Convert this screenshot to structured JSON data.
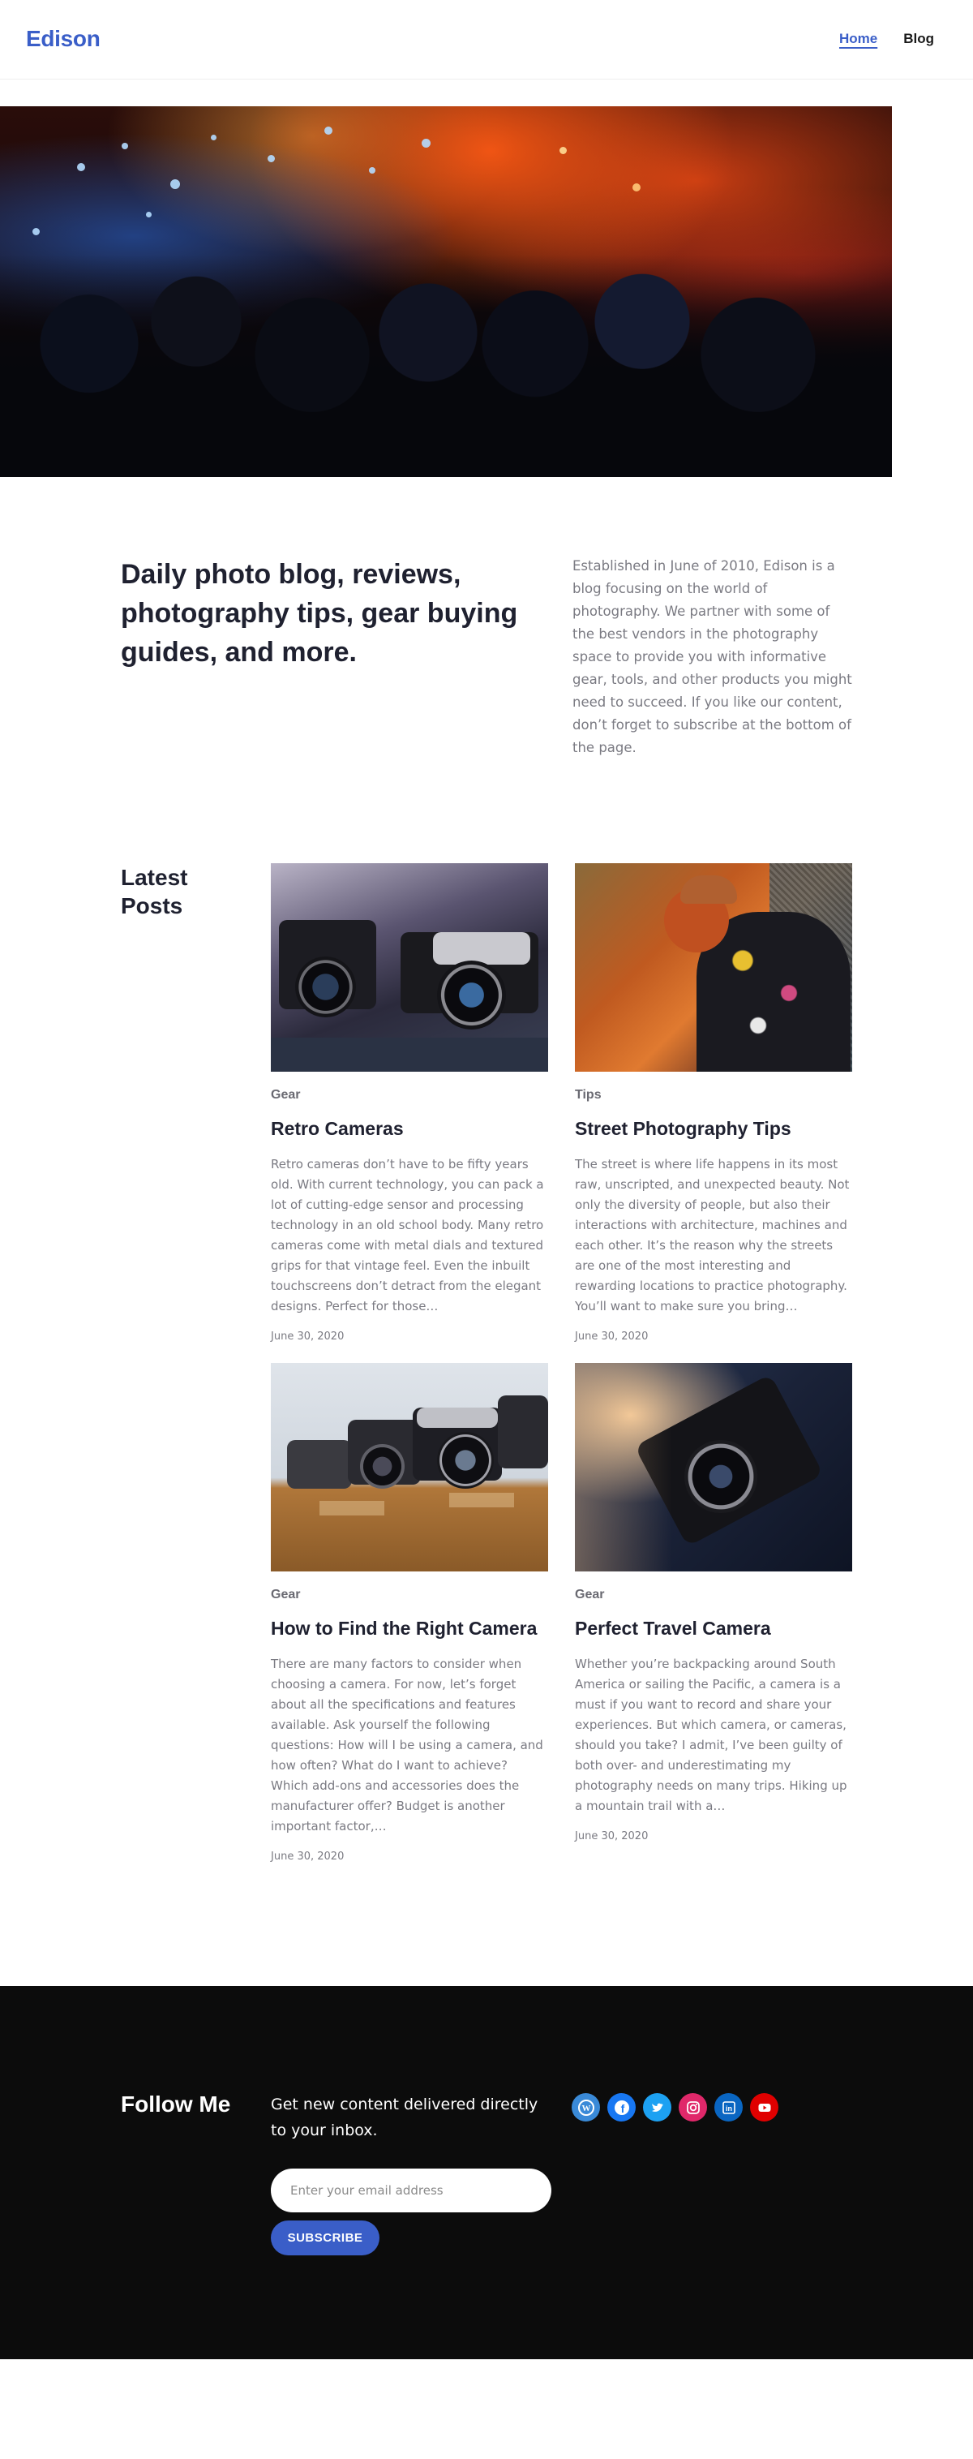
{
  "header": {
    "logo": "Edison",
    "nav": [
      {
        "label": "Home",
        "active": true
      },
      {
        "label": "Blog",
        "active": false
      }
    ]
  },
  "intro": {
    "title": "Daily photo blog, reviews, photography tips, gear buying guides, and more.",
    "text": "Established in June of 2010, Edison is a blog focusing on the world of photography. We partner with some of the best vendors in the photography space to provide you with informative gear, tools, and other products you might need to succeed. If you like our content, don’t forget to subscribe at the bottom of the page."
  },
  "latest": {
    "title": "Latest Posts",
    "posts": [
      {
        "category": "Gear",
        "title": "Retro Cameras",
        "excerpt": "Retro cameras don’t have to be fifty years old. With current technology, you can pack a lot of cutting-edge sensor and processing technology in an old school body. Many retro cameras come with metal dials and textured grips for that vintage feel. Even the inbuilt touchscreens don’t detract from the elegant designs. Perfect for those…",
        "date": "June 30, 2020"
      },
      {
        "category": "Tips",
        "title": "Street Photography Tips",
        "excerpt": "The street is where life happens in its most raw, unscripted, and unexpected beauty. Not only the diversity of people, but also their interactions with architecture, machines and each other. It’s the reason why the streets are one of the most interesting and rewarding locations to practice photography. You’ll want to make sure you bring…",
        "date": "June 30, 2020"
      },
      {
        "category": "Gear",
        "title": "How to Find the Right Camera",
        "excerpt": "There are many factors to consider when choosing a camera. For now, let’s forget about all the specifications and features available. Ask yourself the following questions: How will I be using a camera, and how often? What do I want to achieve? Which add-ons and accessories does the manufacturer offer? Budget is another important factor,…",
        "date": "June 30, 2020"
      },
      {
        "category": "Gear",
        "title": "Perfect Travel Camera",
        "excerpt": "Whether you’re backpacking around South America or sailing the Pacific, a camera is a must if you want to record and share your experiences. But which camera, or cameras, should you take? I admit, I’ve been guilty of both over- and underestimating my photography needs on many trips. Hiking up a mountain trail with a…",
        "date": "June 30, 2020"
      }
    ]
  },
  "footer": {
    "title": "Follow Me",
    "text": "Get new content delivered directly to your inbox.",
    "email_placeholder": "Enter your email address",
    "subscribe_label": "SUBSCRIBE",
    "socials": [
      {
        "icon": "wordpress-icon",
        "glyph": "W",
        "color": "#3a8ad8"
      },
      {
        "icon": "facebook-icon",
        "glyph": "f",
        "color": "#1877f2"
      },
      {
        "icon": "twitter-icon",
        "glyph": "t",
        "color": "#1da1f2"
      },
      {
        "icon": "instagram-icon",
        "glyph": "◎",
        "color": "#e0286a"
      },
      {
        "icon": "linkedin-icon",
        "glyph": "in",
        "color": "#0a66c2"
      },
      {
        "icon": "youtube-icon",
        "glyph": "▶",
        "color": "#e00000"
      }
    ]
  },
  "colors": {
    "accent": "#3a5ec8",
    "footer_bg": "#0c0c0c",
    "text_dark": "#1f2130",
    "text_muted": "#7a7a82"
  }
}
